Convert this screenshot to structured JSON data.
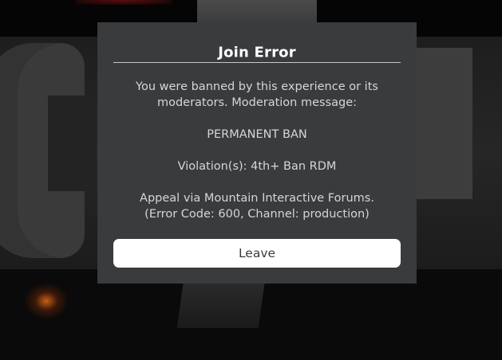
{
  "dialog": {
    "title": "Join Error",
    "message_lines": [
      "You were banned by this experience or its",
      "moderators. Moderation message:",
      "PERMANENT BAN",
      "Violation(s): 4th+ Ban RDM",
      "Appeal via Mountain Interactive Forums.",
      "(Error Code: 600, Channel: production)"
    ],
    "leave_label": "Leave"
  },
  "colors": {
    "dialog_background": "#393b3d",
    "button_background": "#ffffff",
    "title_text": "#ffffff",
    "body_text": "#d6d6d6"
  }
}
